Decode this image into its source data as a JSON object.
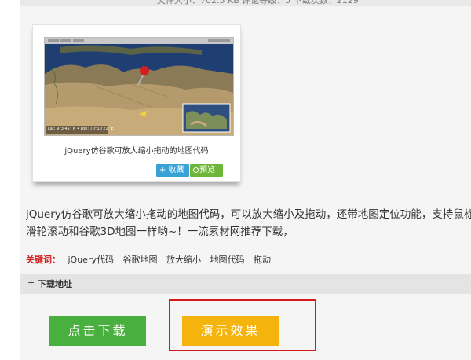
{
  "top_info": {
    "text": "文件大小：702.5 KB    评论等级：5    下载次数：2129"
  },
  "thumbnail": {
    "caption": "jQuery仿谷歌可放大缩小拖动的地图代码",
    "map_coords": "Lat: 9°3'45\" N • Lon: 70°10'21\" E",
    "favorite_label": "+ 收藏",
    "preview_label": "预览"
  },
  "description": {
    "line1": "jQuery仿谷歌可放大缩小拖动的地图代码，可以放大缩小及拖动，还带地图定位功能，支持鼠标",
    "line2": "滑轮滚动和谷歌3D地图一样哟~！一流素材网推荐下载，"
  },
  "keywords": {
    "label": "关键词：",
    "items": [
      "jQuery代码",
      "谷歌地图",
      "放大缩小",
      "地图代码",
      "拖动"
    ]
  },
  "download_section": {
    "title": "下载地址",
    "download_label": "点击下载",
    "demo_label": "演示效果"
  },
  "colors": {
    "download_button": "#49af3f",
    "demo_button": "#f5b40d",
    "highlight_border": "#d21a1a",
    "keyword_label": "#d2201f"
  }
}
